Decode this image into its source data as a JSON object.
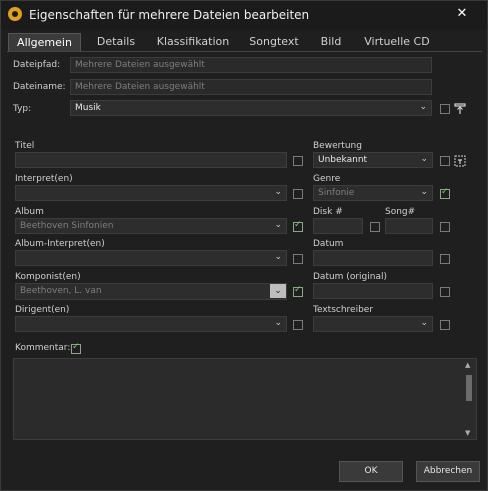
{
  "window": {
    "title": "Eigenschaften für mehrere Dateien bearbeiten"
  },
  "tabs": [
    "Allgemein",
    "Details",
    "Klassifikation",
    "Songtext",
    "Bild",
    "Virtuelle CD"
  ],
  "fields": {
    "dateipfad": {
      "label": "Dateipfad:",
      "value": "Mehrere Dateien ausgewählt"
    },
    "dateiname": {
      "label": "Dateiname:",
      "value": "Mehrere Dateien ausgewählt"
    },
    "typ": {
      "label": "Typ:",
      "value": "Musik"
    },
    "titel": {
      "label": "Titel",
      "value": ""
    },
    "interpret": {
      "label": "Interpret(en)",
      "value": ""
    },
    "album": {
      "label": "Album",
      "value": "Beethoven Sinfonien"
    },
    "album_interpret": {
      "label": "Album-Interpret(en)",
      "value": ""
    },
    "komponist": {
      "label": "Komponist(en)",
      "value": "Beethoven, L. van"
    },
    "dirigent": {
      "label": "Dirigent(en)",
      "value": ""
    },
    "bewertung": {
      "label": "Bewertung",
      "value": "Unbekannt"
    },
    "genre": {
      "label": "Genre",
      "value": "Sinfonie"
    },
    "disk": {
      "label": "Disk #",
      "value": ""
    },
    "song": {
      "label": "Song#",
      "value": ""
    },
    "datum": {
      "label": "Datum",
      "value": ""
    },
    "datum_original": {
      "label": "Datum (original)",
      "value": ""
    },
    "textschreiber": {
      "label": "Textschreiber",
      "value": ""
    },
    "kommentar": {
      "label": "Kommentar:",
      "value": ""
    }
  },
  "checked": {
    "typ": false,
    "titel": false,
    "interpret": false,
    "album": true,
    "album_interpret": false,
    "komponist": true,
    "dirigent": false,
    "bewertung": false,
    "genre": true,
    "disk": false,
    "song": false,
    "datum": false,
    "datum_original": false,
    "textschreiber": false,
    "kommentar": true
  },
  "buttons": {
    "ok": "OK",
    "cancel": "Abbrechen"
  },
  "icons": {
    "close": "✕",
    "dropdown": "⌄",
    "scroll_up": "▲",
    "scroll_down": "▼"
  }
}
